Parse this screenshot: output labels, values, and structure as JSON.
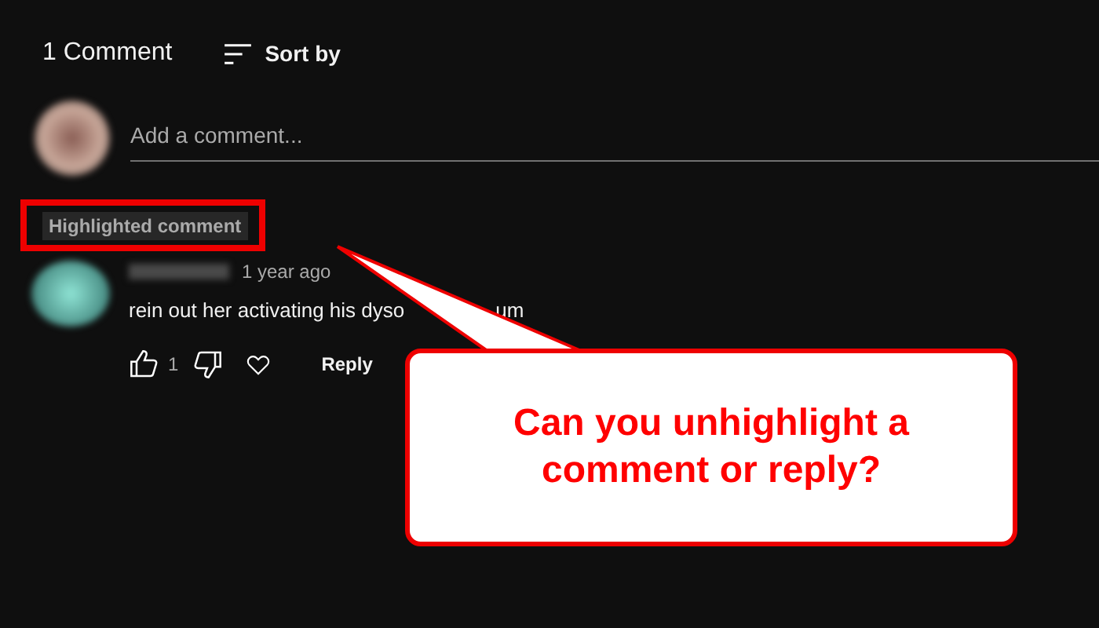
{
  "header": {
    "count_label": "1 Comment",
    "sort_label": "Sort by"
  },
  "add_comment": {
    "placeholder": "Add a comment..."
  },
  "highlighted_label": "Highlighted comment",
  "comment": {
    "time": "1 year ago",
    "text_parts": [
      "rein out her activating his dyso",
      "um"
    ],
    "likes": "1",
    "reply_label": "Reply"
  },
  "annotation": {
    "text": "Can you unhighlight a comment or reply?"
  }
}
